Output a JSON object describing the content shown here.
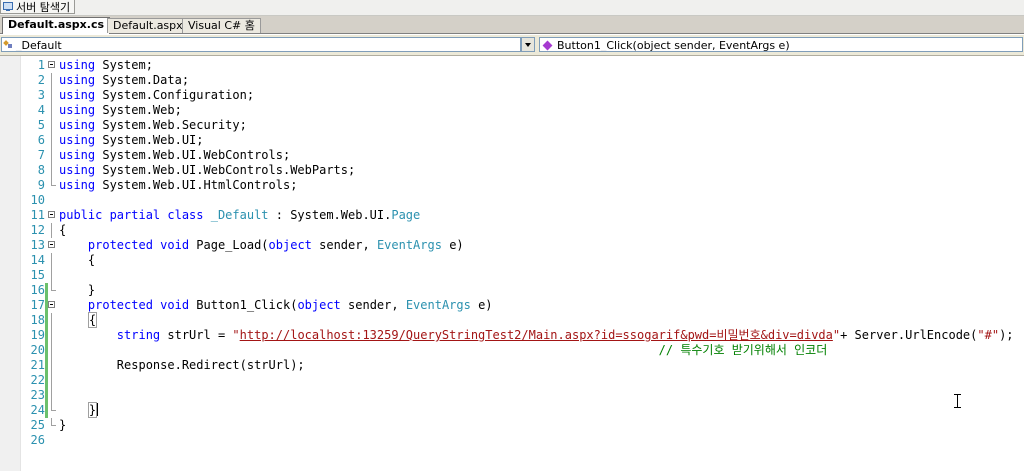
{
  "server_explorer": {
    "label": "서버 탐색기"
  },
  "tabs": [
    {
      "label": "Default.aspx.cs"
    },
    {
      "label": "Default.aspx"
    },
    {
      "label": "Visual C# 홈"
    }
  ],
  "nav": {
    "class_dropdown": "_Default",
    "member_dropdown": "Button1_Click(object sender, EventArgs e)"
  },
  "lines": [
    {
      "n": "1",
      "t": [
        {
          "c": "kw",
          "v": "using"
        },
        {
          "v": " System;"
        }
      ]
    },
    {
      "n": "2",
      "t": [
        {
          "c": "kw",
          "v": "using"
        },
        {
          "v": " System.Data;"
        }
      ]
    },
    {
      "n": "3",
      "t": [
        {
          "c": "kw",
          "v": "using"
        },
        {
          "v": " System.Configuration;"
        }
      ]
    },
    {
      "n": "4",
      "t": [
        {
          "c": "kw",
          "v": "using"
        },
        {
          "v": " System.Web;"
        }
      ]
    },
    {
      "n": "5",
      "t": [
        {
          "c": "kw",
          "v": "using"
        },
        {
          "v": " System.Web.Security;"
        }
      ]
    },
    {
      "n": "6",
      "t": [
        {
          "c": "kw",
          "v": "using"
        },
        {
          "v": " System.Web.UI;"
        }
      ]
    },
    {
      "n": "7",
      "t": [
        {
          "c": "kw",
          "v": "using"
        },
        {
          "v": " System.Web.UI.WebControls;"
        }
      ]
    },
    {
      "n": "8",
      "t": [
        {
          "c": "kw",
          "v": "using"
        },
        {
          "v": " System.Web.UI.WebControls.WebParts;"
        }
      ]
    },
    {
      "n": "9",
      "t": [
        {
          "c": "kw",
          "v": "using"
        },
        {
          "v": " System.Web.UI.HtmlControls;"
        }
      ]
    },
    {
      "n": "10",
      "t": []
    },
    {
      "n": "11",
      "t": [
        {
          "c": "kw",
          "v": "public partial class"
        },
        {
          "v": " "
        },
        {
          "c": "ty",
          "v": "_Default"
        },
        {
          "v": " : System.Web.UI."
        },
        {
          "c": "ty",
          "v": "Page"
        }
      ]
    },
    {
      "n": "12",
      "t": [
        {
          "v": "{"
        }
      ]
    },
    {
      "n": "13",
      "t": [
        {
          "v": "    "
        },
        {
          "c": "kw",
          "v": "protected void"
        },
        {
          "v": " Page_Load("
        },
        {
          "c": "kw",
          "v": "object"
        },
        {
          "v": " sender, "
        },
        {
          "c": "ty",
          "v": "EventArgs"
        },
        {
          "v": " e)"
        }
      ]
    },
    {
      "n": "14",
      "t": [
        {
          "v": "    {"
        }
      ]
    },
    {
      "n": "15",
      "t": []
    },
    {
      "n": "16",
      "t": [
        {
          "v": "    }"
        }
      ]
    },
    {
      "n": "17",
      "t": [
        {
          "v": "    "
        },
        {
          "c": "kw",
          "v": "protected void"
        },
        {
          "v": " Button1_Click("
        },
        {
          "c": "kw",
          "v": "object"
        },
        {
          "v": " sender, "
        },
        {
          "c": "ty",
          "v": "EventArgs"
        },
        {
          "v": " e)"
        }
      ]
    },
    {
      "n": "18",
      "t": [
        {
          "v": "    "
        },
        {
          "c": "brace-hl",
          "v": "{"
        }
      ]
    },
    {
      "n": "19",
      "t": [
        {
          "v": "        "
        },
        {
          "c": "kw",
          "v": "string"
        },
        {
          "v": " strUrl = "
        },
        {
          "c": "str",
          "v": "\""
        },
        {
          "c": "url",
          "v": "http://localhost:13259/QueryStringTest2/Main.aspx?id=ssogarif&pwd=비밀번호&div=divda"
        },
        {
          "c": "str",
          "v": "\""
        },
        {
          "v": "+ Server.UrlEncode("
        },
        {
          "c": "str",
          "v": "\"#\""
        },
        {
          "v": ");"
        }
      ]
    },
    {
      "n": "20",
      "t": [
        {
          "v": "                                                                                   "
        },
        {
          "c": "cmt",
          "v": "// 특수기호 받기위해서 인코더"
        }
      ]
    },
    {
      "n": "21",
      "t": [
        {
          "v": "        Response.Redirect(strUrl);"
        }
      ]
    },
    {
      "n": "22",
      "t": []
    },
    {
      "n": "23",
      "t": []
    },
    {
      "n": "24",
      "t": [
        {
          "v": "    "
        },
        {
          "c": "brace-hl",
          "v": "}"
        },
        {
          "c": "caret",
          "v": ""
        }
      ]
    },
    {
      "n": "25",
      "t": [
        {
          "v": "}"
        }
      ]
    },
    {
      "n": "26",
      "t": []
    }
  ]
}
